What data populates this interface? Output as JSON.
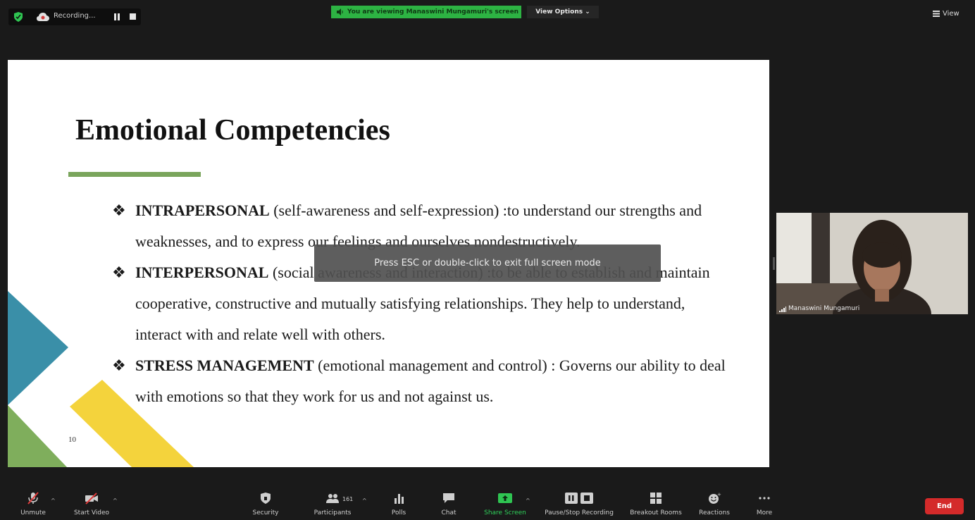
{
  "top_bar": {
    "recording_label": "Recording...",
    "viewing_banner": "You are viewing Manaswini Mungamuri's screen",
    "view_options": "View Options ⌄",
    "view_label": "View"
  },
  "slide": {
    "title": "Emotional Competencies",
    "bullets": [
      {
        "heading": "INTRAPERSONAL",
        "text": " (self-awareness and self-expression) :to understand our strengths and weaknesses, and to express our feelings and ourselves nondestructively."
      },
      {
        "heading": "INTERPERSONAL",
        "text": " (social awareness and interaction) :to be able to establish and maintain cooperative, constructive and mutually satisfying relationships. They help to understand, interact with and relate well with others."
      },
      {
        "heading": "STRESS MANAGEMENT",
        "text": " (emotional management and control) : Governs our ability to deal with emotions so that they work for us and not against us."
      }
    ],
    "bullet_marker": "❖",
    "page_number": "10",
    "accent_color": "#7aa55c"
  },
  "toast": {
    "message": "Press ESC or double-click to exit full screen mode"
  },
  "video": {
    "participant_name": "Manaswini Mungamuri"
  },
  "toolbar": {
    "unmute": "Unmute",
    "start_video": "Start Video",
    "security": "Security",
    "participants": "Participants",
    "participants_count": "161",
    "polls": "Polls",
    "chat": "Chat",
    "share_screen": "Share Screen",
    "pause_stop_recording": "Pause/Stop Recording",
    "breakout_rooms": "Breakout Rooms",
    "reactions": "Reactions",
    "more": "More",
    "end": "End"
  }
}
